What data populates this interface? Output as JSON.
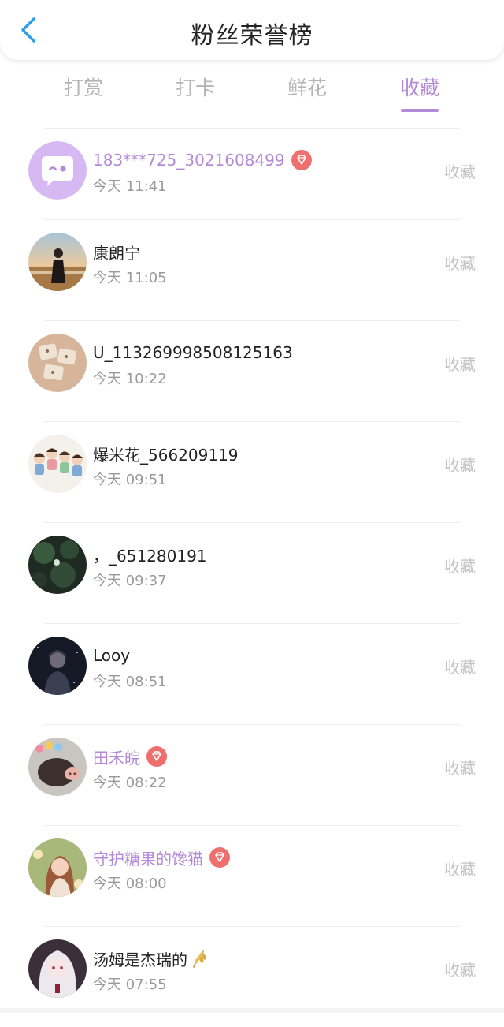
{
  "header": {
    "title": "粉丝荣誉榜",
    "back_icon": "chevron-left-icon"
  },
  "tabs": [
    {
      "label": "打赏",
      "active": false
    },
    {
      "label": "打卡",
      "active": false
    },
    {
      "label": "鲜花",
      "active": false
    },
    {
      "label": "收藏",
      "active": true
    }
  ],
  "colors": {
    "accent": "#b48ad8",
    "badge_red": "#ef6f6f",
    "back_blue": "#2f9fe8",
    "action_gray": "#c4c4c4",
    "time_gray": "#9a9a9a"
  },
  "list": [
    {
      "name": "183***725_3021608499",
      "time": "今天 11:41",
      "action": "收藏",
      "vip": true,
      "badge": "diamond-badge-icon",
      "avatar": "chat-bubble-avatar"
    },
    {
      "name": "康朗宁",
      "time": "今天 11:05",
      "action": "收藏",
      "vip": false,
      "avatar": "girl-field-photo-avatar"
    },
    {
      "name": "U_113269998508125163",
      "time": "今天 10:22",
      "action": "收藏",
      "vip": false,
      "avatar": "beige-sticker-avatar"
    },
    {
      "name": "爆米花_566209119",
      "time": "今天 09:51",
      "action": "收藏",
      "vip": false,
      "avatar": "cartoon-group-avatar"
    },
    {
      "name": "，_651280191",
      "time": "今天 09:37",
      "action": "收藏",
      "vip": false,
      "avatar": "green-foliage-avatar"
    },
    {
      "name": "Looy",
      "time": "今天 08:51",
      "action": "收藏",
      "vip": false,
      "avatar": "dark-portrait-avatar"
    },
    {
      "name": "田禾皖",
      "time": "今天 08:22",
      "action": "收藏",
      "vip": true,
      "badge": "diamond-badge-icon",
      "avatar": "pig-doll-avatar"
    },
    {
      "name": "守护糖果的馋猫",
      "time": "今天 08:00",
      "action": "收藏",
      "vip": true,
      "badge": "diamond-badge-icon",
      "avatar": "girl-flowers-avatar"
    },
    {
      "name": "汤姆是杰瑞的",
      "time": "今天 07:55",
      "action": "收藏",
      "vip": false,
      "emoji": "wheat-icon",
      "avatar": "anime-girl-avatar"
    }
  ]
}
